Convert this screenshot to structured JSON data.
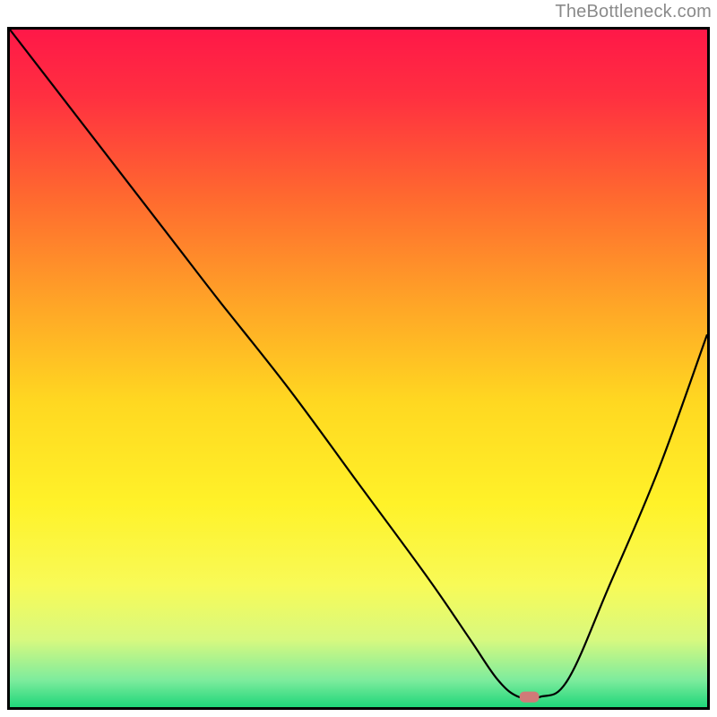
{
  "watermark": "TheBottleneck.com",
  "chart_data": {
    "type": "line",
    "title": "",
    "xlabel": "",
    "ylabel": "",
    "xlim": [
      0,
      100
    ],
    "ylim": [
      0,
      100
    ],
    "grid": false,
    "legend": false,
    "background": {
      "kind": "vertical_gradient",
      "stops": [
        {
          "offset": 0.0,
          "color": "#ff1848"
        },
        {
          "offset": 0.1,
          "color": "#ff3040"
        },
        {
          "offset": 0.25,
          "color": "#ff6a2f"
        },
        {
          "offset": 0.4,
          "color": "#ffa327"
        },
        {
          "offset": 0.55,
          "color": "#ffd821"
        },
        {
          "offset": 0.7,
          "color": "#fff229"
        },
        {
          "offset": 0.82,
          "color": "#f8fa57"
        },
        {
          "offset": 0.9,
          "color": "#d8f97f"
        },
        {
          "offset": 0.96,
          "color": "#7eec9d"
        },
        {
          "offset": 1.0,
          "color": "#1fd67a"
        }
      ]
    },
    "series": [
      {
        "name": "bottleneck_curve",
        "x": [
          0,
          6,
          12,
          18,
          24,
          30,
          40,
          50,
          60,
          66,
          70,
          73,
          76,
          80,
          86,
          93,
          100
        ],
        "y": [
          100,
          92,
          84,
          76,
          68,
          60,
          47,
          33,
          19,
          10,
          4,
          1.5,
          1.5,
          4,
          18,
          35,
          55
        ]
      }
    ],
    "marker": {
      "name": "bottleneck_marker",
      "x": 74.5,
      "y": 1.5,
      "shape": "rounded_rect",
      "color": "#d07a78",
      "width_pct": 2.8,
      "height_pct": 1.6
    }
  }
}
